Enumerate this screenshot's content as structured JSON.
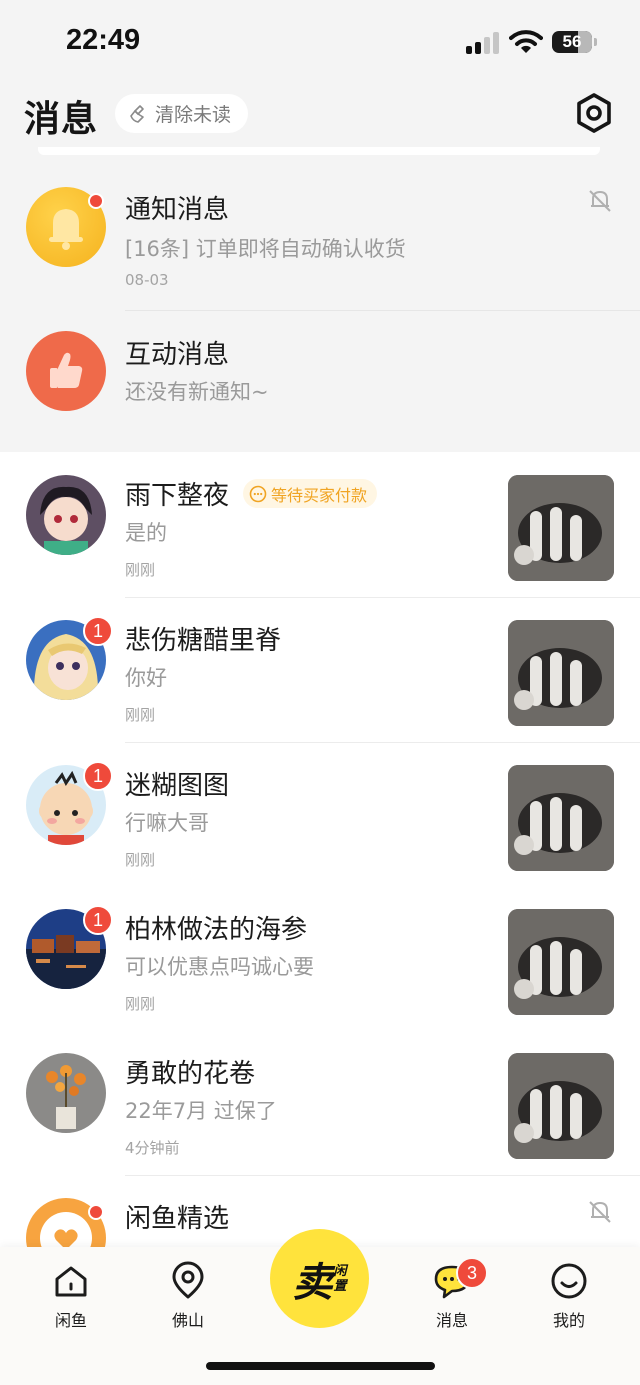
{
  "status_bar": {
    "time": "22:49",
    "battery": "56"
  },
  "header": {
    "title": "消息",
    "clear_unread_label": "清除未读"
  },
  "system_rows": [
    {
      "title": "通知消息",
      "subtitle": "[16条] 订单即将自动确认收货",
      "date": "08-03",
      "icon": "bell-icon",
      "unread_dot": true,
      "muted": true
    },
    {
      "title": "互动消息",
      "subtitle": "还没有新通知~",
      "date": "",
      "icon": "thumbs-up-icon",
      "unread_dot": false,
      "muted": false
    }
  ],
  "chats": [
    {
      "name": "雨下整夜",
      "tag": "等待买家付款",
      "message": "是的",
      "time": "刚刚",
      "badge": ""
    },
    {
      "name": "悲伤糖醋里脊",
      "tag": "",
      "message": "你好",
      "time": "刚刚",
      "badge": "1"
    },
    {
      "name": "迷糊图图",
      "tag": "",
      "message": "行嘛大哥",
      "time": "刚刚",
      "badge": "1"
    },
    {
      "name": "柏林做法的海参",
      "tag": "",
      "message": "可以优惠点吗诚心要",
      "time": "刚刚",
      "badge": "1"
    },
    {
      "name": "勇敢的花卷",
      "tag": "",
      "message": "22年7月 过保了",
      "time": "4分钟前",
      "badge": ""
    },
    {
      "name": "闲鱼精选",
      "tag": "",
      "message": "",
      "time": "",
      "badge": ""
    }
  ],
  "tab_bar": {
    "tabs": [
      {
        "label": "闲鱼",
        "icon": "home-icon"
      },
      {
        "label": "佛山",
        "icon": "location-pin-icon"
      },
      {
        "label": "消息",
        "icon": "chat-bubble-icon",
        "badge": "3"
      },
      {
        "label": "我的",
        "icon": "smiley-profile-icon"
      }
    ],
    "sell_button": {
      "main": "卖",
      "side_1": "闲",
      "side_2": "置"
    }
  },
  "colors": {
    "accent_yellow": "#ffe33c",
    "badge_red": "#ef4a3b",
    "tag_orange": "#f0a423",
    "interaction_orange": "#ef6a4a"
  }
}
